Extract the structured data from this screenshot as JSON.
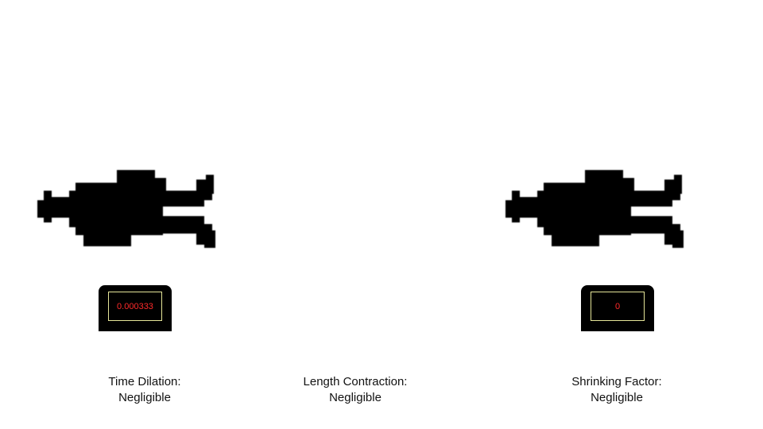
{
  "clocks": {
    "left": {
      "reading": "0.000333"
    },
    "right": {
      "reading": "0"
    }
  },
  "captions": {
    "time_dilation": {
      "label": "Time Dilation:",
      "value": "Negligible"
    },
    "length_contraction": {
      "label": "Length Contraction:",
      "value": "Negligible"
    },
    "shrinking_factor": {
      "label": "Shrinking Factor:",
      "value": "Negligible"
    }
  },
  "colors": {
    "background": "#ffffff",
    "figure": "#000000",
    "clock_body": "#000000",
    "clock_screen_border": "#e6e699",
    "clock_digits": "#ff2a2a"
  },
  "icons": {
    "figure": "pixel-person-lying-icon",
    "clock": "digital-clock-icon"
  }
}
